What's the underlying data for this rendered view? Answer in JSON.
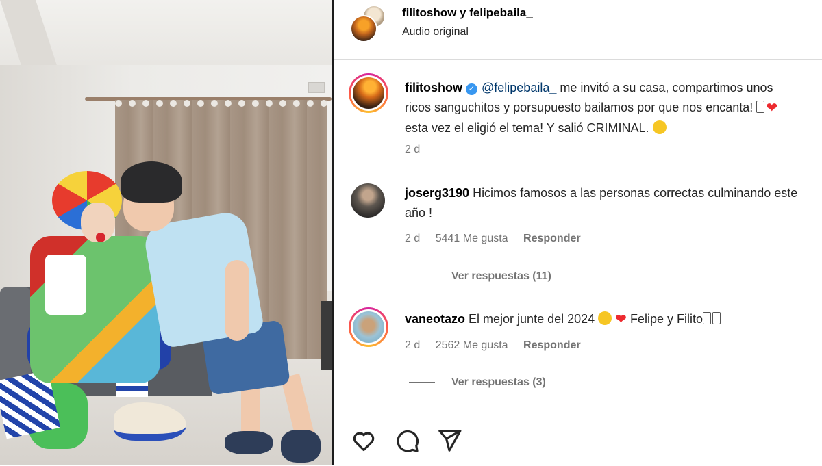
{
  "header": {
    "title": "filitoshow y felipebaila_",
    "subtitle": "Audio original"
  },
  "caption": {
    "username": "filitoshow",
    "mention": "@felipebaila_",
    "text_1": " me invitó a su casa, compartimos unos ricos sanguchitos y porsupuesto bailamos por que nos encanta! ",
    "text_2": " esta vez el eligió el tema! Y salió CRIMINAL. ",
    "time": "2 d"
  },
  "comments": [
    {
      "username": "joserg3190",
      "text": " Hicimos famosos a las personas correctas culminando este año !",
      "time": "2 d",
      "likes": "5441 Me gusta",
      "reply": "Responder",
      "view_replies": "Ver respuestas (11)"
    },
    {
      "username": "vaneotazo",
      "text_1": " El mejor junte del 2024 ",
      "text_2": " Felipe y Filito",
      "time": "2 d",
      "likes": "2562 Me gusta",
      "reply": "Responder",
      "view_replies": "Ver respuestas (3)"
    }
  ],
  "actions": {
    "icons": [
      "heart-icon",
      "comment-icon",
      "share-icon"
    ]
  },
  "colors": {
    "mention": "#00376b",
    "secondary_text": "#737373",
    "verified": "#3897f0"
  }
}
